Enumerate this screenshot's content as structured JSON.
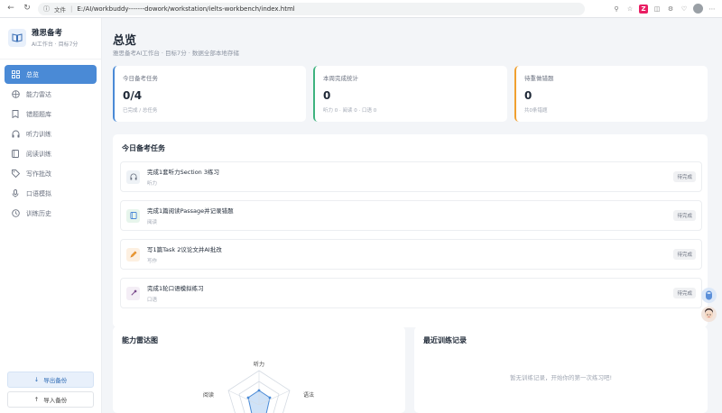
{
  "browser": {
    "url_chip": "文件",
    "url": "E:/AI/workbuddy-------dowork/workstation/ielts-workbench/index.html"
  },
  "sidebar": {
    "brand_title": "雅思备考",
    "brand_sub": "AI工作台 · 目标7分",
    "items": [
      {
        "label": "总览",
        "icon": "grid-icon"
      },
      {
        "label": "能力雷达",
        "icon": "radar-icon"
      },
      {
        "label": "错题题库",
        "icon": "bookmark-icon"
      },
      {
        "label": "听力训练",
        "icon": "headphones-icon"
      },
      {
        "label": "阅读训练",
        "icon": "book-icon"
      },
      {
        "label": "写作批改",
        "icon": "tag-icon"
      },
      {
        "label": "口语模拟",
        "icon": "mic-icon"
      },
      {
        "label": "训练历史",
        "icon": "clock-icon"
      }
    ],
    "export_label": "导出备份",
    "import_label": "导入备份"
  },
  "header": {
    "title": "总览",
    "subtitle": "雅思备考AI工作台 · 目标7分 · 数据全部本地存储"
  },
  "stats": [
    {
      "label": "今日备考任务",
      "value": "0/4",
      "hint": "已完成 / 总任务",
      "color": "#4a8ad6"
    },
    {
      "label": "本周完成统计",
      "value": "0",
      "hint": "听力 0 · 阅读 0 · 口语 0",
      "color": "#3fb37f"
    },
    {
      "label": "待重做错题",
      "value": "0",
      "hint": "共0条错题",
      "color": "#f0a030"
    }
  ],
  "tasks_card": {
    "title": "今日备考任务",
    "items": [
      {
        "title": "完成1套听力Section 3练习",
        "tag": "听力",
        "status": "待完成",
        "icon": "headphones-icon"
      },
      {
        "title": "完成1篇阅读Passage并记录错题",
        "tag": "阅读",
        "status": "待完成",
        "icon": "book-icon"
      },
      {
        "title": "写1篇Task 2议论文并AI批改",
        "tag": "写作",
        "status": "待完成",
        "icon": "pen-icon"
      },
      {
        "title": "完成1轮口语模拟练习",
        "tag": "口语",
        "status": "待完成",
        "icon": "mic-icon"
      }
    ]
  },
  "radar_card": {
    "title": "能力雷达图",
    "labels": [
      "听力",
      "语法",
      "阅读"
    ]
  },
  "history_card": {
    "title": "最近训练记录",
    "empty": "暂无训练记录，开始你的第一次练习吧!"
  }
}
